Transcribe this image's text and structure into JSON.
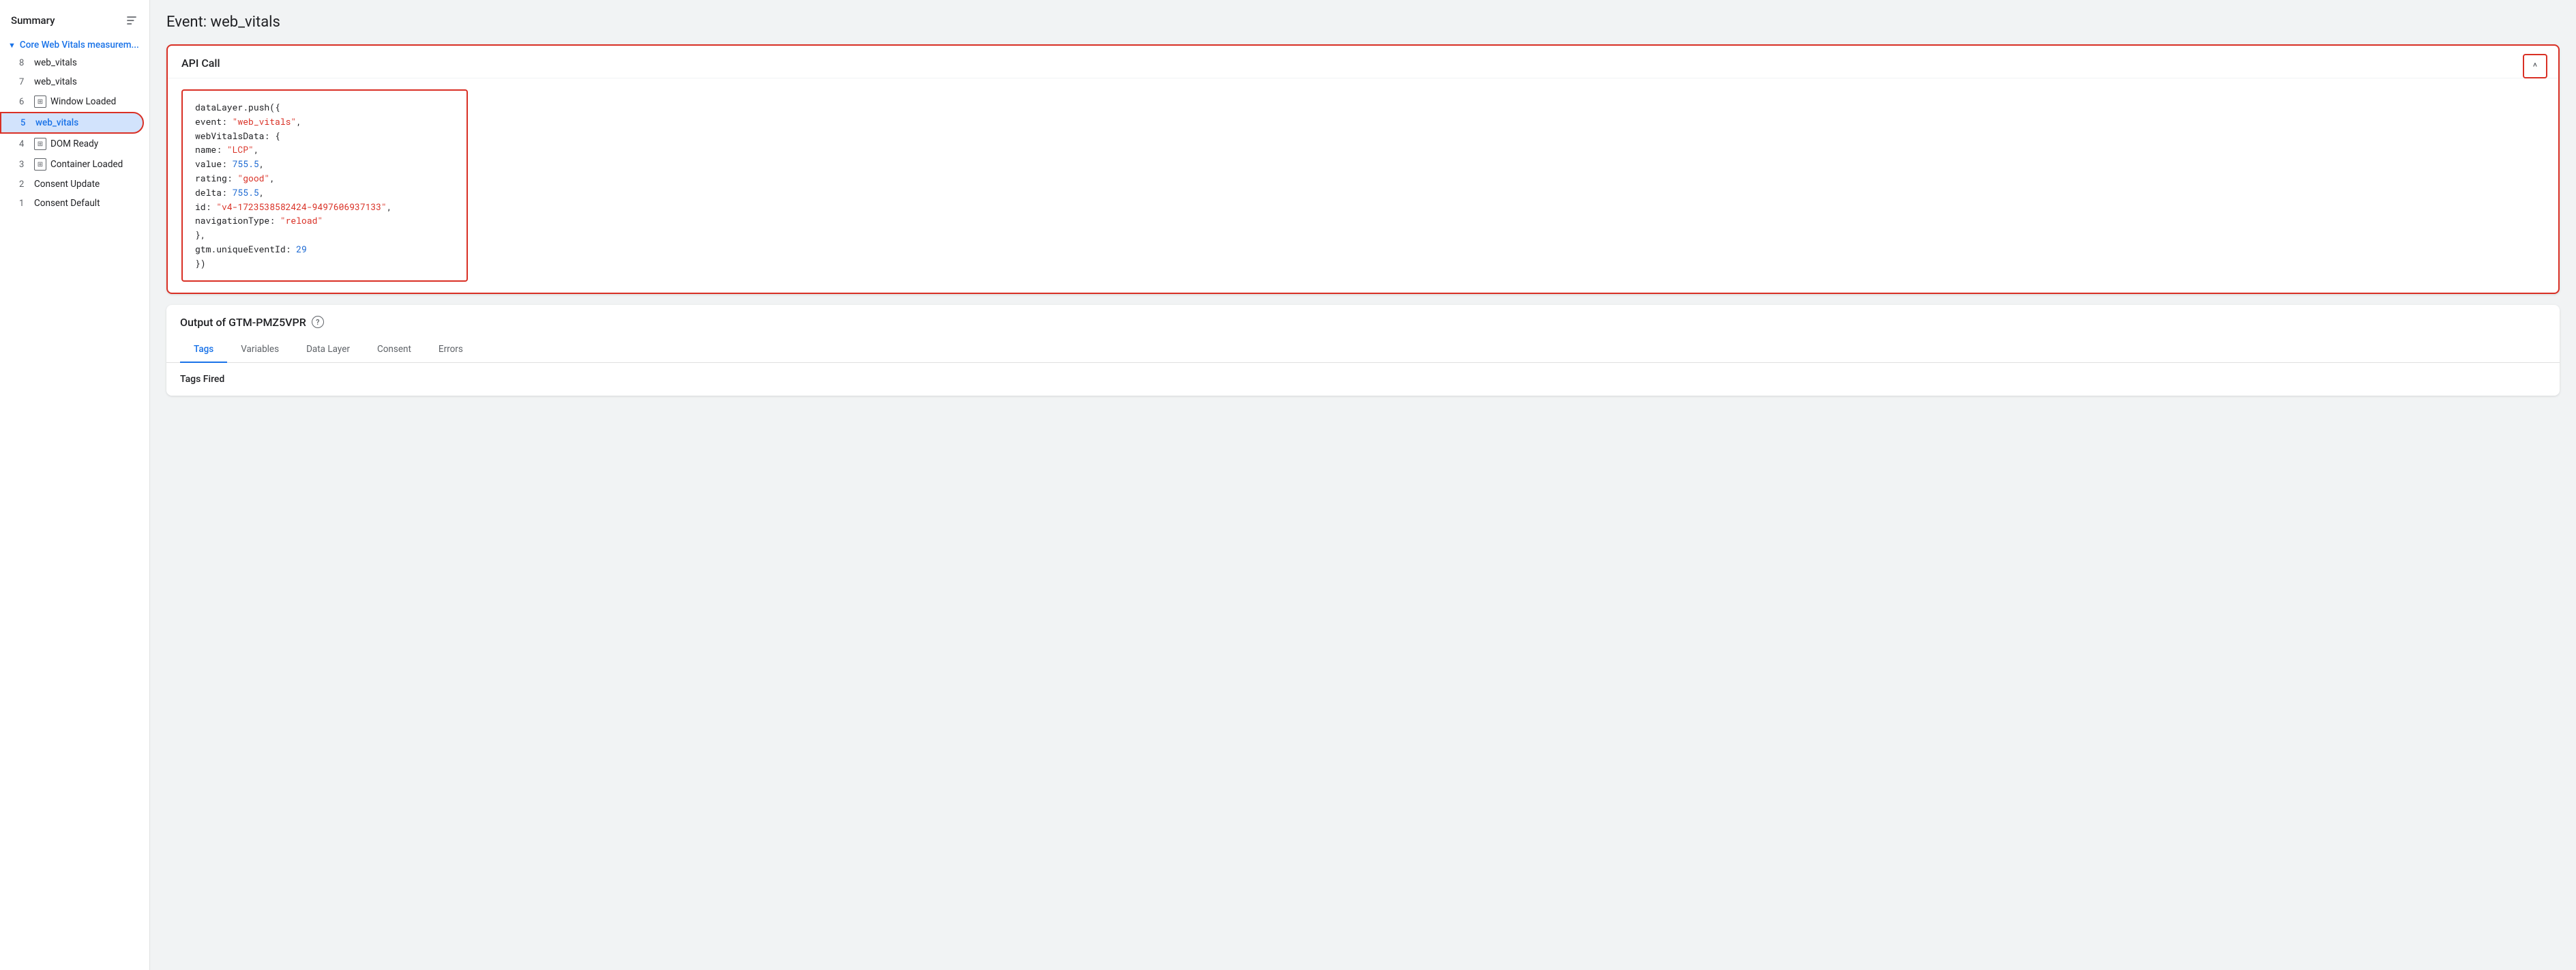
{
  "sidebar": {
    "title": "Summary",
    "icon_label": "filter-icon",
    "group": {
      "label": "Core Web Vitals measurem...",
      "chevron": "▼"
    },
    "events": [
      {
        "num": "8",
        "label": "web_vitals",
        "icon": null,
        "active": false
      },
      {
        "num": "7",
        "label": "web_vitals",
        "icon": null,
        "active": false
      },
      {
        "num": "6",
        "label": "Window Loaded",
        "icon": "◧",
        "active": false
      },
      {
        "num": "5",
        "label": "web_vitals",
        "icon": null,
        "active": true
      },
      {
        "num": "4",
        "label": "DOM Ready",
        "icon": "◧",
        "active": false
      },
      {
        "num": "3",
        "label": "Container Loaded",
        "icon": "◧",
        "active": false
      },
      {
        "num": "2",
        "label": "Consent Update",
        "icon": null,
        "active": false
      },
      {
        "num": "1",
        "label": "Consent Default",
        "icon": null,
        "active": false
      }
    ]
  },
  "page_title": "Event: web_vitals",
  "api_call": {
    "section_title": "API Call",
    "code_lines": [
      {
        "text": "dataLayer.push({",
        "type": "plain"
      },
      {
        "text": "    event: ",
        "type": "plain",
        "value": "\"web_vitals\"",
        "value_type": "str",
        "suffix": ","
      },
      {
        "text": "    webVitalsData: {",
        "type": "plain"
      },
      {
        "text": "        name: ",
        "type": "plain",
        "value": "\"LCP\"",
        "value_type": "str",
        "suffix": ","
      },
      {
        "text": "        value: ",
        "type": "plain",
        "value": "755.5",
        "value_type": "num",
        "suffix": ","
      },
      {
        "text": "        rating: ",
        "type": "plain",
        "value": "\"good\"",
        "value_type": "str",
        "suffix": ","
      },
      {
        "text": "        delta: ",
        "type": "plain",
        "value": "755.5",
        "value_type": "num",
        "suffix": ","
      },
      {
        "text": "        id: ",
        "type": "plain",
        "value": "\"v4-1723538582424-9497606937133\"",
        "value_type": "str",
        "suffix": ","
      },
      {
        "text": "        navigationType: ",
        "type": "plain",
        "value": "\"reload\"",
        "value_type": "str"
      },
      {
        "text": "    },",
        "type": "plain"
      },
      {
        "text": "    gtm.uniqueEventId: ",
        "type": "plain",
        "value": "29",
        "value_type": "num"
      },
      {
        "text": "})",
        "type": "plain"
      }
    ],
    "collapse_btn_label": "^"
  },
  "output": {
    "section_title": "Output of GTM-PMZ5VPR",
    "help_icon": "?",
    "tabs": [
      {
        "label": "Tags",
        "active": true
      },
      {
        "label": "Variables",
        "active": false
      },
      {
        "label": "Data Layer",
        "active": false
      },
      {
        "label": "Consent",
        "active": false
      },
      {
        "label": "Errors",
        "active": false
      }
    ],
    "tags_fired_label": "Tags Fired"
  },
  "colors": {
    "accent_blue": "#1a73e8",
    "accent_red": "#d93025",
    "str_color": "#d93025",
    "num_color": "#1967d2"
  }
}
